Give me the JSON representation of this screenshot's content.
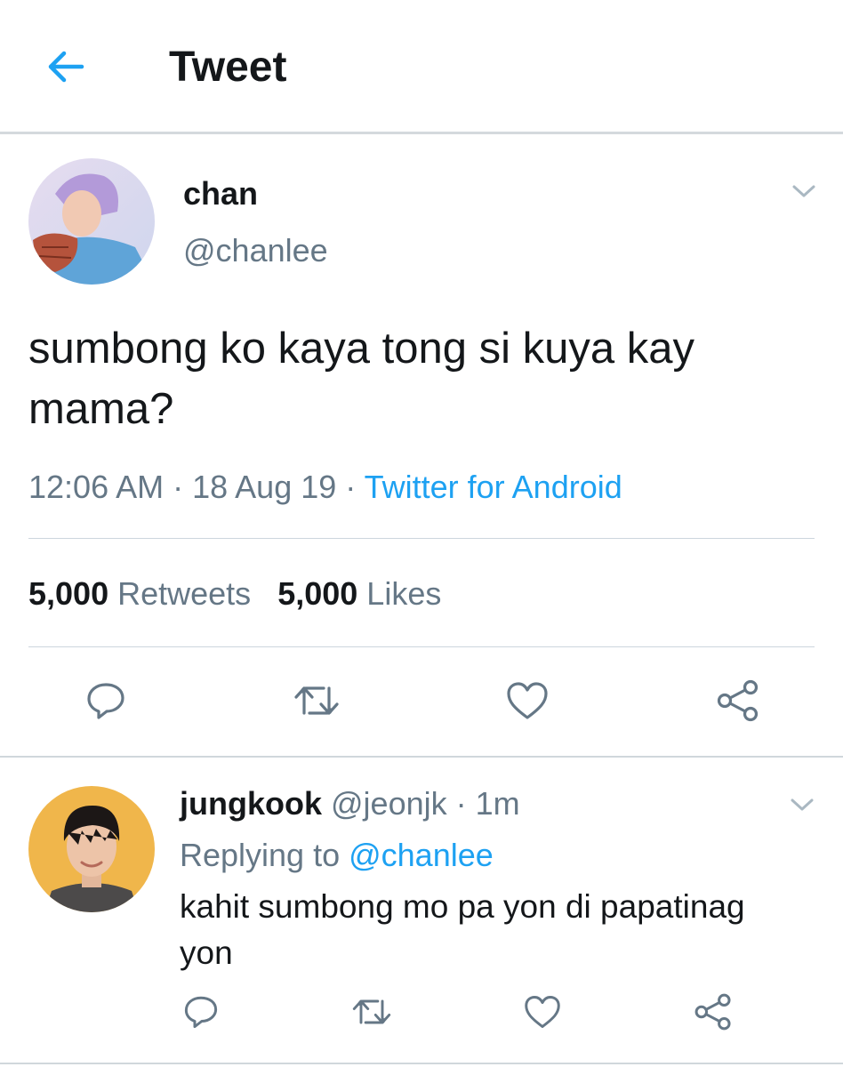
{
  "header": {
    "title": "Tweet",
    "back_icon": "arrow-left-icon",
    "accent": "#1da1f2"
  },
  "tweet": {
    "author_name": "chan",
    "author_handle": "@chanlee",
    "text": "sumbong ko kaya tong si kuya kay mama?",
    "time": "12:06 AM",
    "sep1": " · ",
    "date": "18 Aug 19",
    "sep2": " · ",
    "source": "Twitter for Android",
    "retweets_count": "5,000",
    "retweets_label": "Retweets",
    "likes_count": "5,000",
    "likes_label": "Likes",
    "actions": [
      "reply-icon",
      "retweet-icon",
      "like-icon",
      "share-icon"
    ]
  },
  "reply": {
    "author_name": "jungkook",
    "author_handle": "@jeonjk",
    "sep": " · ",
    "time": "1m",
    "replying_prefix": "Replying to ",
    "replying_to": "@chanlee",
    "text": "kahit sumbong mo pa yon di papatinag yon",
    "actions": [
      "reply-icon",
      "retweet-icon",
      "like-icon",
      "share-icon"
    ]
  },
  "colors": {
    "text": "#14171a",
    "secondary": "#657786",
    "link": "#1da1f2",
    "divider": "#ccd6dd"
  }
}
